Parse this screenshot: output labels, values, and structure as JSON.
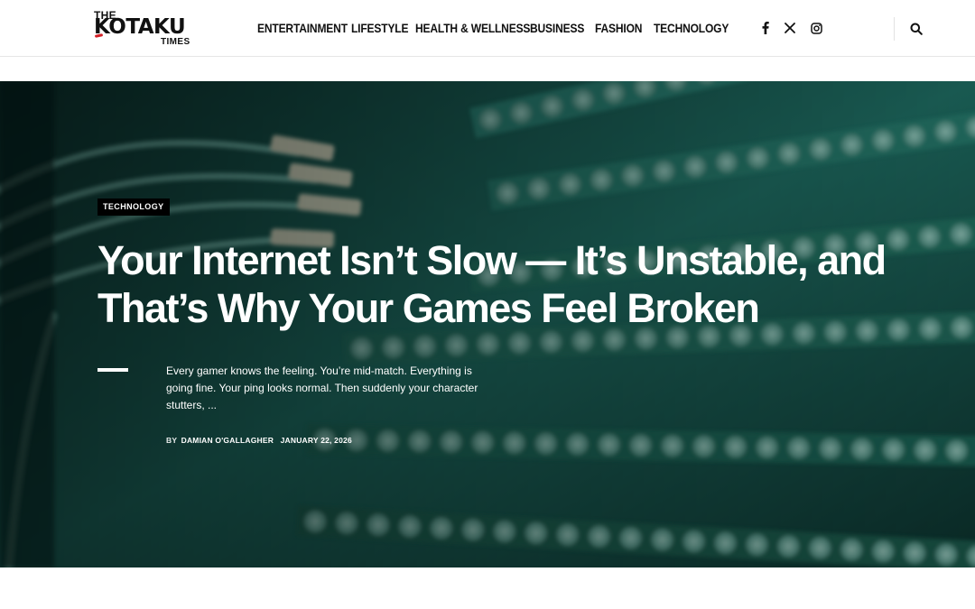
{
  "site": {
    "logo_top": "THE",
    "logo_main": "KOTAKU",
    "logo_bottom": "TIMES",
    "accent_color": "#d21f26"
  },
  "nav": {
    "items": [
      {
        "label": "ENTERTAINMENT"
      },
      {
        "label": "LIFESTYLE"
      },
      {
        "label": "HEALTH & WELLNESS"
      },
      {
        "label": "BUSINESS"
      },
      {
        "label": "FASHION"
      },
      {
        "label": "TECHNOLOGY"
      }
    ]
  },
  "social": {
    "icons": [
      "facebook-icon",
      "x-icon",
      "instagram-icon"
    ]
  },
  "search": {
    "icon": "search-icon"
  },
  "hero": {
    "category": "TECHNOLOGY",
    "title": "Your Internet Isn’t Slow — It’s Unstable, and That’s Why Your Games Feel Broken",
    "excerpt": "Every gamer knows the feeling. You’re mid-match. Everything is going fine. Your ping looks normal. Then suddenly your character stutters, ...",
    "by": "BY",
    "author": "DAMIAN O'GALLAGHER",
    "date": "JANUARY 22, 2026",
    "image_tint": "#1f6e63"
  }
}
